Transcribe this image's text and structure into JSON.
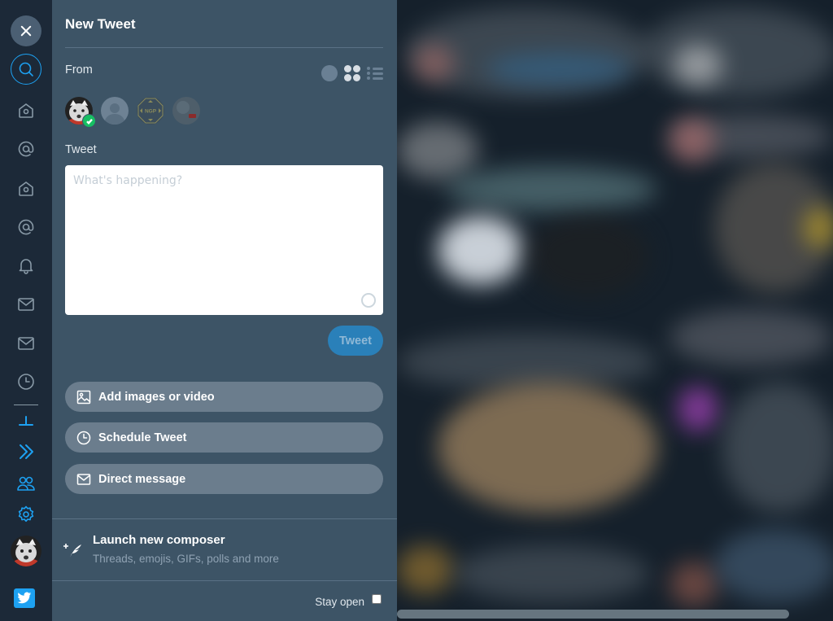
{
  "nav": {
    "items": [
      {
        "name": "close",
        "icon": "close-icon"
      },
      {
        "name": "search",
        "icon": "search-icon"
      },
      {
        "name": "home-1",
        "icon": "home-icon"
      },
      {
        "name": "mentions-1",
        "icon": "at-icon"
      },
      {
        "name": "home-2",
        "icon": "home-icon"
      },
      {
        "name": "mentions-2",
        "icon": "at-icon"
      },
      {
        "name": "notifications",
        "icon": "bell-icon"
      },
      {
        "name": "messages-1",
        "icon": "mail-icon"
      },
      {
        "name": "messages-2",
        "icon": "mail-icon"
      },
      {
        "name": "scheduled",
        "icon": "clock-icon"
      },
      {
        "name": "collapse",
        "icon": "collapse-icon"
      },
      {
        "name": "expand",
        "icon": "double-chevron-icon"
      },
      {
        "name": "accounts",
        "icon": "users-icon"
      },
      {
        "name": "settings",
        "icon": "gear-icon"
      }
    ]
  },
  "composer": {
    "title": "New Tweet",
    "from_label": "From",
    "accounts": [
      {
        "name": "account-1",
        "selected": true
      },
      {
        "name": "account-2",
        "selected": false
      },
      {
        "name": "account-3",
        "selected": false,
        "badge": "NGP"
      },
      {
        "name": "account-4",
        "selected": false
      }
    ],
    "tweet_label": "Tweet",
    "tweet_placeholder": "What's happening?",
    "tweet_value": "",
    "tweet_button": "Tweet",
    "actions": [
      {
        "label": "Add images or video",
        "icon": "image-icon"
      },
      {
        "label": "Schedule Tweet",
        "icon": "clock-icon"
      },
      {
        "label": "Direct message",
        "icon": "mail-icon"
      }
    ],
    "launch": {
      "title": "Launch new composer",
      "subtitle": "Threads, emojis, GIFs, polls and more"
    },
    "stay_open_label": "Stay open",
    "stay_open_checked": false
  },
  "colors": {
    "accent": "#1da1f2",
    "drawer_bg": "#3d5466",
    "nav_bg": "#1c2938",
    "page_bg": "#15202b",
    "success": "#17bf63"
  }
}
